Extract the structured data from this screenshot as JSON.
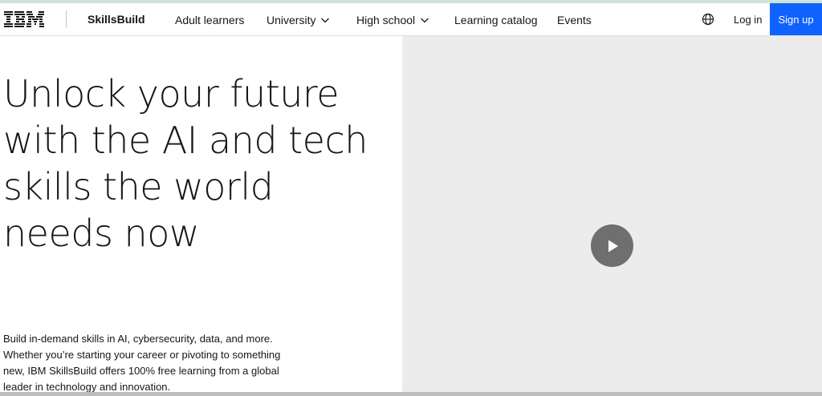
{
  "nav": {
    "logo_text": "IBM",
    "brand": "SkillsBuild",
    "items": [
      {
        "label": "Adult learners",
        "has_dropdown": false
      },
      {
        "label": "University",
        "has_dropdown": true
      },
      {
        "label": "High school",
        "has_dropdown": true
      },
      {
        "label": "Learning catalog",
        "has_dropdown": false
      },
      {
        "label": "Events",
        "has_dropdown": false
      }
    ],
    "globe_icon": "globe-icon",
    "login_label": "Log in",
    "signup_label": "Sign up"
  },
  "hero": {
    "title": "Unlock your future with the AI and tech skills the world needs now",
    "description": "Build in-demand skills in AI, cybersecurity, data, and more. Whether you’re starting your career or pivoting to something new, IBM SkillsBuild offers 100% free learning from a global leader in technology and innovation."
  },
  "video": {
    "play_icon": "play-icon"
  },
  "colors": {
    "accent": "#0f62fe",
    "video_bg": "#ececec",
    "play_button": "#6f6f6f"
  }
}
